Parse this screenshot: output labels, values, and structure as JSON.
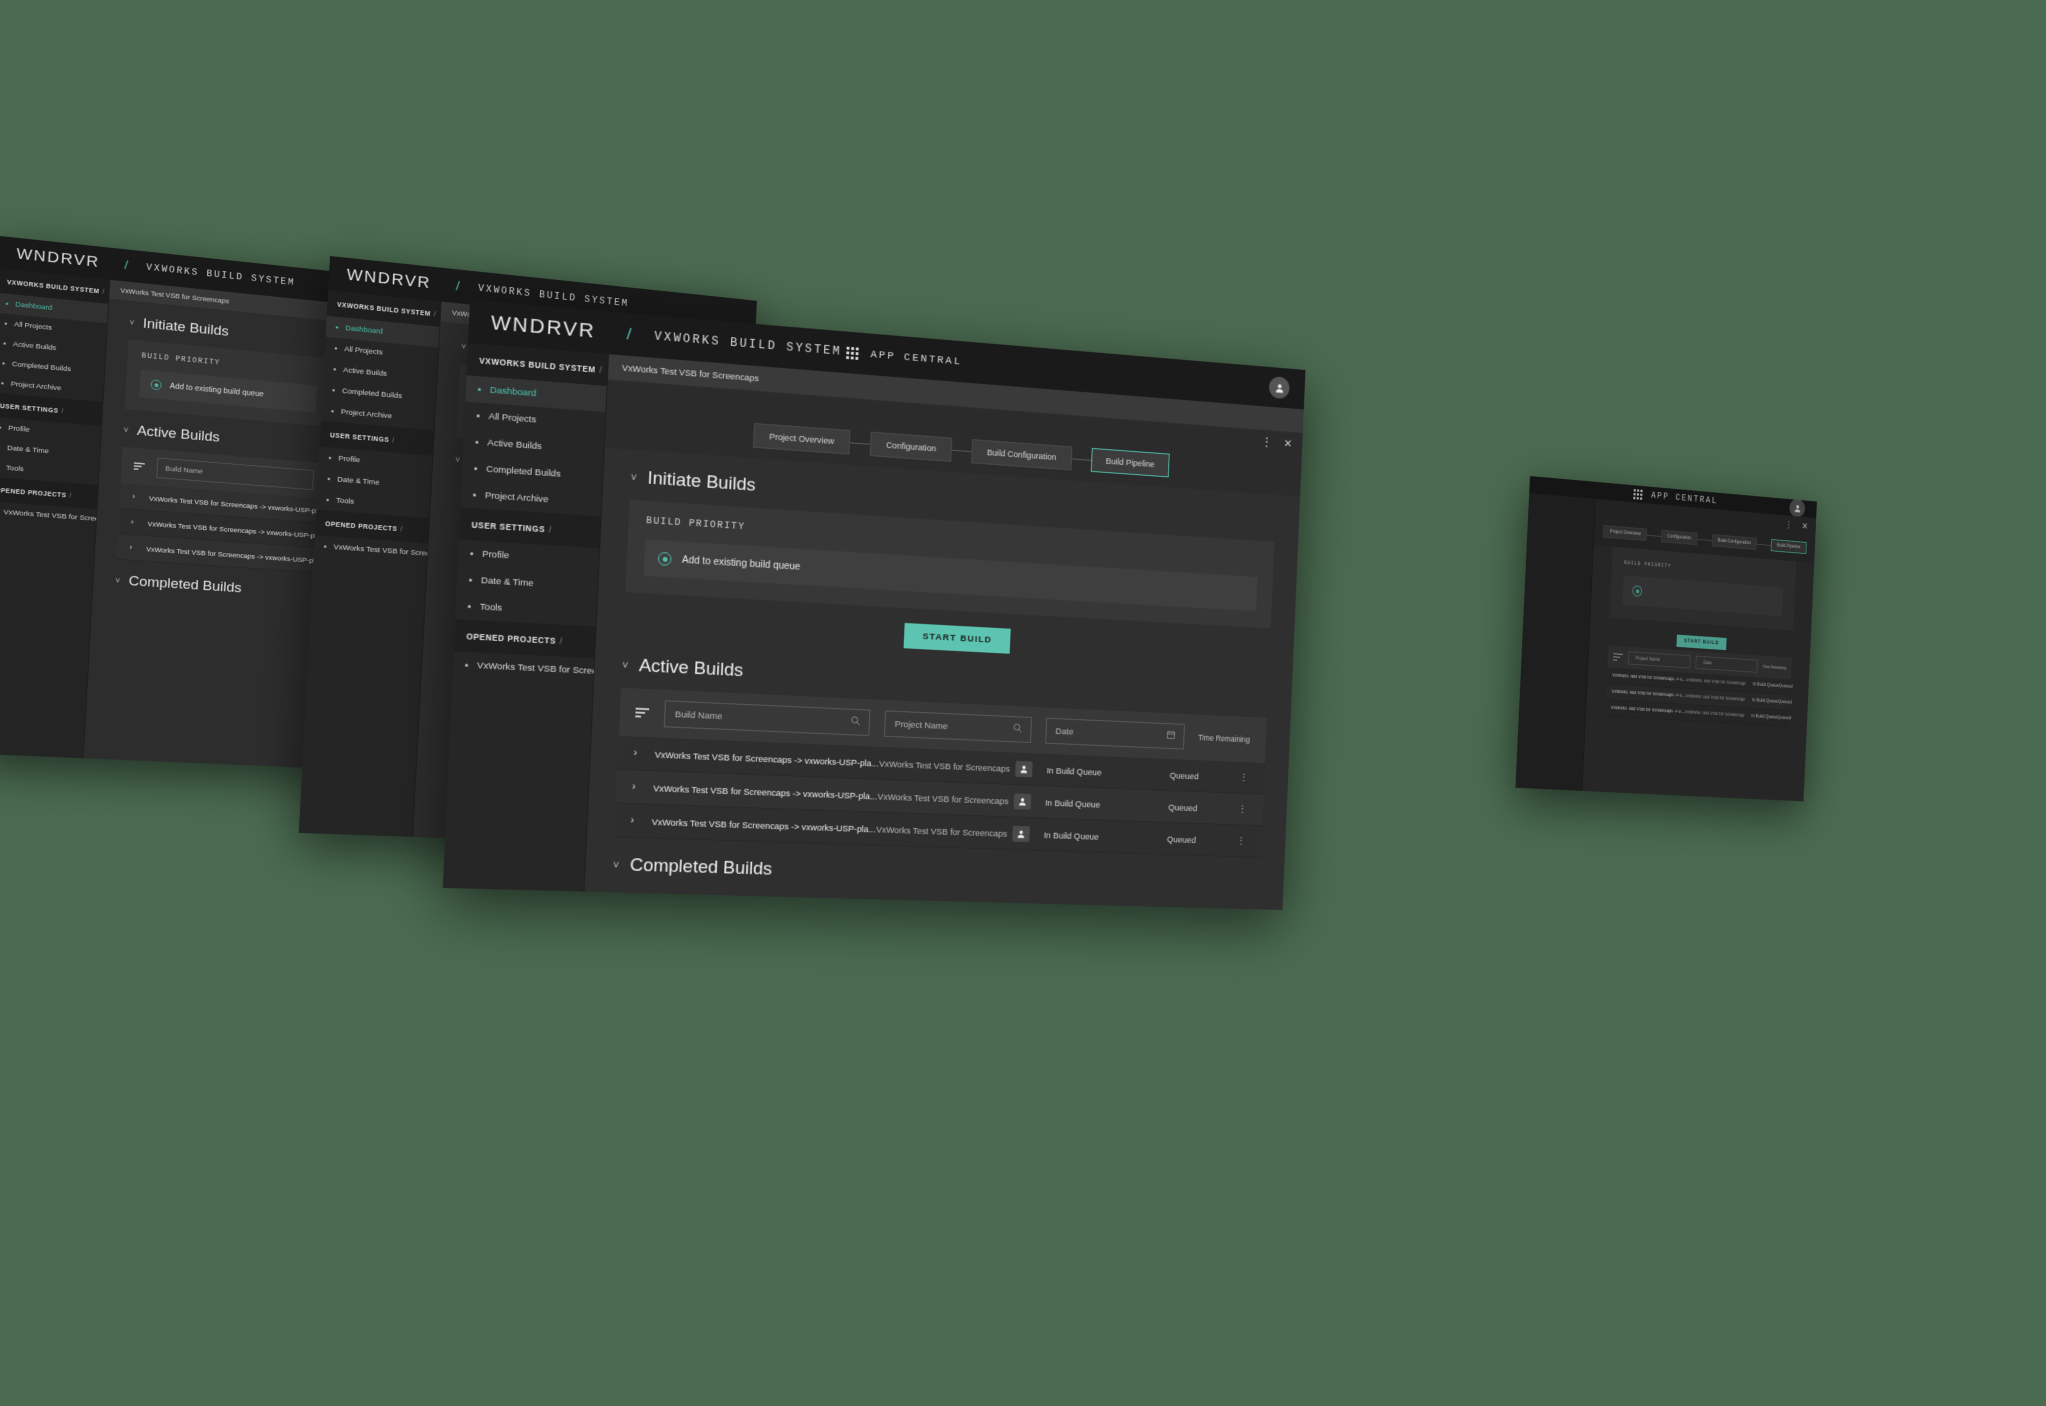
{
  "brand": {
    "logo": "WNDRVR",
    "separator": "/",
    "product": "VXWORKS BUILD SYSTEM"
  },
  "app_bar": {
    "grid_icon": "grid-apps-icon",
    "label": "APP CENTRAL",
    "avatar_icon": "user-avatar-icon"
  },
  "sidebar": {
    "groups": [
      {
        "title": "VXWORKS BUILD SYSTEM",
        "slash": "/",
        "items": [
          {
            "label": "Dashboard",
            "active": true
          },
          {
            "label": "All Projects",
            "active": false
          },
          {
            "label": "Active Builds",
            "active": false
          },
          {
            "label": "Completed Builds",
            "active": false
          },
          {
            "label": "Project Archive",
            "active": false
          }
        ]
      },
      {
        "title": "USER SETTINGS",
        "slash": "/",
        "items": [
          {
            "label": "Profile",
            "active": false
          },
          {
            "label": "Date & Time",
            "active": false
          },
          {
            "label": "Tools",
            "active": false
          }
        ]
      },
      {
        "title": "OPENED PROJECTS",
        "slash": "/",
        "items": [
          {
            "label": "VxWorks Test VSB for Screencaps",
            "active": false
          }
        ]
      }
    ]
  },
  "breadcrumb": {
    "project": "VxWorks Test VSB for Screencaps"
  },
  "panel_controls": {
    "kebab": "⋮",
    "close": "✕"
  },
  "tabs": [
    {
      "label": "Project Overview",
      "active": false
    },
    {
      "label": "Configuration",
      "active": false
    },
    {
      "label": "Build Configuration",
      "active": false
    },
    {
      "label": "Build Pipeline",
      "active": true
    }
  ],
  "initiate_builds": {
    "title": "Initiate Builds",
    "chevron": "˅",
    "card_label": "BUILD PRIORITY",
    "radio_label": "Add to existing build queue",
    "radio_selected": true,
    "start_button": "START BUILD"
  },
  "active_builds": {
    "title": "Active Builds",
    "chevron": "˅",
    "filter_icon": "filter-lines-icon",
    "filters": {
      "build_name_placeholder": "Build Name",
      "build_name_icon": "search-icon",
      "project_name_placeholder": "Project Name",
      "project_name_icon": "search-icon",
      "date_placeholder": "Date",
      "date_icon": "calendar-icon"
    },
    "columns": {
      "time_remaining": "Time Remaining"
    },
    "rows": [
      {
        "expand": "›",
        "build_name": "VxWorks Test VSB for Screencaps -> vxworks-USP-pla...",
        "project_name": "VxWorks Test VSB for Screencaps",
        "owner_icon": "user-icon",
        "status": "In Build Queue",
        "time_remaining": "Queued",
        "kebab": "⋮"
      },
      {
        "expand": "›",
        "build_name": "VxWorks Test VSB for Screencaps -> vxworks-USP-pla...",
        "project_name": "VxWorks Test VSB for Screencaps",
        "owner_icon": "user-icon",
        "status": "In Build Queue",
        "time_remaining": "Queued",
        "kebab": "⋮"
      },
      {
        "expand": "›",
        "build_name": "VxWorks Test VSB for Screencaps -> vxworks-USP-pla...",
        "project_name": "VxWorks Test VSB for Screencaps",
        "owner_icon": "user-icon",
        "status": "In Build Queue",
        "time_remaining": "Queued",
        "kebab": "⋮"
      }
    ]
  },
  "completed_builds": {
    "title": "Completed Builds",
    "chevron": "˅"
  },
  "colors": {
    "accent": "#4fc3ad",
    "button": "#5cc4b0",
    "background": "#2f2f2f",
    "topbar": "#1a1a1a",
    "sidebar": "#262626",
    "card": "#373737",
    "canvas": "#4a6b50"
  }
}
